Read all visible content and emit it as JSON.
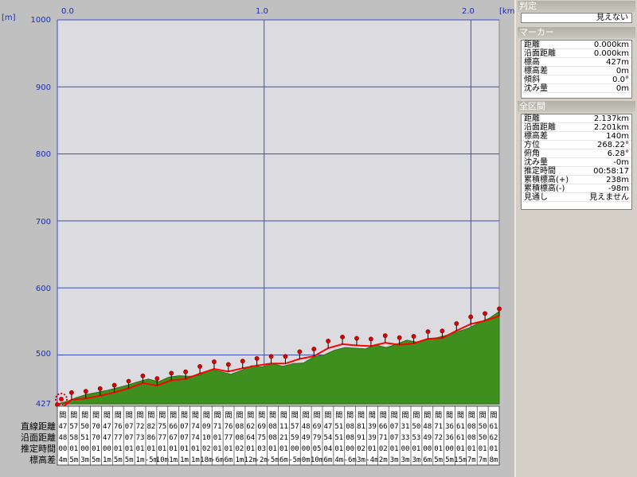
{
  "x_axis": {
    "ticks": [
      "0.0",
      "1.0",
      "2.0"
    ],
    "unit": "[km]"
  },
  "y_axis": {
    "unit": "[m]",
    "ticks": [
      "1000",
      "900",
      "800",
      "700",
      "600",
      "500"
    ],
    "bottom_label": "427"
  },
  "row_labels": [
    "直線距離",
    "沿面距離",
    "推定時間",
    "標高差"
  ],
  "segment_columns": [
    {
      "header": "間",
      "r1": "47",
      "r2": "48",
      "r3": "00",
      "r4": "4m"
    },
    {
      "header": "間",
      "r1": "57",
      "r2": "58",
      "r3": "01",
      "r4": "5m"
    },
    {
      "header": "間",
      "r1": "50",
      "r2": "51",
      "r3": "00",
      "r4": "3m"
    },
    {
      "header": "間",
      "r1": "70",
      "r2": "70",
      "r3": "01",
      "r4": "5m"
    },
    {
      "header": "間",
      "r1": "47",
      "r2": "47",
      "r3": "00",
      "r4": "1m"
    },
    {
      "header": "間",
      "r1": "76",
      "r2": "77",
      "r3": "01",
      "r4": "5m"
    },
    {
      "header": "間",
      "r1": "07",
      "r2": "07",
      "r3": "01",
      "r4": "5m"
    },
    {
      "header": "間",
      "r1": "72",
      "r2": "73",
      "r3": "01",
      "r4": "1m"
    },
    {
      "header": "間",
      "r1": "82",
      "r2": "86",
      "r3": "01",
      "r4": "-5m"
    },
    {
      "header": "間",
      "r1": "75",
      "r2": "77",
      "r3": "01",
      "r4": "10m"
    },
    {
      "header": "間",
      "r1": "66",
      "r2": "67",
      "r3": "01",
      "r4": "1m"
    },
    {
      "header": "間",
      "r1": "07",
      "r2": "07",
      "r3": "01",
      "r4": "1m"
    },
    {
      "header": "間",
      "r1": "74",
      "r2": "74",
      "r3": "01",
      "r4": "1m"
    },
    {
      "header": "間",
      "r1": "09",
      "r2": "10",
      "r3": "02",
      "r4": "18m"
    },
    {
      "header": "間",
      "r1": "71",
      "r2": "01",
      "r3": "01",
      "r4": "-6m"
    },
    {
      "header": "間",
      "r1": "76",
      "r2": "77",
      "r3": "01",
      "r4": "6m"
    },
    {
      "header": "間",
      "r1": "08",
      "r2": "08",
      "r3": "02",
      "r4": "1m"
    },
    {
      "header": "間",
      "r1": "62",
      "r2": "64",
      "r3": "01",
      "r4": "12m"
    },
    {
      "header": "間",
      "r1": "69",
      "r2": "75",
      "r3": "03",
      "r4": "-2m"
    },
    {
      "header": "間",
      "r1": "08",
      "r2": "08",
      "r3": "01",
      "r4": "-5m"
    },
    {
      "header": "間",
      "r1": "11",
      "r2": "21",
      "r3": "01",
      "r4": "6m"
    },
    {
      "header": "間",
      "r1": "57",
      "r2": "59",
      "r3": "00",
      "r4": "-5m"
    },
    {
      "header": "間",
      "r1": "48",
      "r2": "49",
      "r3": "00",
      "r4": "0m"
    },
    {
      "header": "間",
      "r1": "69",
      "r2": "79",
      "r3": "05",
      "r4": "10m"
    },
    {
      "header": "間",
      "r1": "47",
      "r2": "54",
      "r3": "04",
      "r4": "6m"
    },
    {
      "header": "間",
      "r1": "51",
      "r2": "51",
      "r3": "01",
      "r4": "4m"
    },
    {
      "header": "間",
      "r1": "08",
      "r2": "08",
      "r3": "00",
      "r4": "-6m"
    },
    {
      "header": "間",
      "r1": "81",
      "r2": "91",
      "r3": "02",
      "r4": "3m"
    },
    {
      "header": "間",
      "r1": "39",
      "r2": "39",
      "r3": "01",
      "r4": "-4m"
    },
    {
      "header": "間",
      "r1": "66",
      "r2": "71",
      "r3": "02",
      "r4": "2m"
    },
    {
      "header": "間",
      "r1": "07",
      "r2": "07",
      "r3": "01",
      "r4": "3m"
    },
    {
      "header": "間",
      "r1": "31",
      "r2": "33",
      "r3": "00",
      "r4": "3m"
    },
    {
      "header": "間",
      "r1": "50",
      "r2": "53",
      "r3": "01",
      "r4": "3m"
    },
    {
      "header": "間",
      "r1": "48",
      "r2": "49",
      "r3": "00",
      "r4": "6m"
    },
    {
      "header": "間",
      "r1": "71",
      "r2": "72",
      "r3": "01",
      "r4": "5m"
    },
    {
      "header": "間",
      "r1": "36",
      "r2": "36",
      "r3": "00",
      "r4": "5m"
    },
    {
      "header": "間",
      "r1": "61",
      "r2": "61",
      "r3": "01",
      "r4": "15m"
    },
    {
      "header": "間",
      "r1": "08",
      "r2": "08",
      "r3": "01",
      "r4": "7m"
    },
    {
      "header": "間",
      "r1": "50",
      "r2": "50",
      "r3": "01",
      "r4": "7m"
    },
    {
      "header": "間",
      "r1": "61",
      "r2": "62",
      "r3": "01",
      "r4": "8m"
    }
  ],
  "right_panel": {
    "judge_title": "判定",
    "judge_value": "見えない",
    "marker_title": "マーカー",
    "marker_rows": [
      {
        "label": "距離",
        "value": "0.000km"
      },
      {
        "label": "沿面距離",
        "value": "0.000km"
      },
      {
        "label": "標高",
        "value": "427m"
      },
      {
        "label": "標高差",
        "value": "0m"
      },
      {
        "label": "傾斜",
        "value": "0.0°"
      },
      {
        "label": "沈み量",
        "value": "0m"
      }
    ],
    "total_title": "全区間",
    "total_rows": [
      {
        "label": "距離",
        "value": "2.137km"
      },
      {
        "label": "沿面距離",
        "value": "2.201km"
      },
      {
        "label": "標高差",
        "value": "140m"
      },
      {
        "label": "方位",
        "value": "268.22°"
      },
      {
        "label": "俯角",
        "value": "6.28°"
      },
      {
        "label": "沈み量",
        "value": "-0m"
      },
      {
        "label": "推定時間",
        "value": "00:58:17"
      },
      {
        "label": "累積標高(+)",
        "value": "238m"
      },
      {
        "label": "累積標高(-)",
        "value": "-98m"
      },
      {
        "label": "見通し",
        "value": "見えません"
      }
    ]
  },
  "chart_data": {
    "type": "area",
    "xlabel": "[km]",
    "ylabel": "[m]",
    "xlim": [
      0,
      2.137
    ],
    "ylim": [
      427,
      1000
    ],
    "x_ticks": [
      0.0,
      1.0,
      2.0
    ],
    "y_ticks": [
      500,
      600,
      700,
      800,
      900,
      1000
    ],
    "grid": true,
    "terrain_color": "#3f8f1f",
    "route_color": "#ff0000",
    "series": [
      {
        "x": [
          0.0,
          0.05,
          0.09,
          0.14,
          0.19,
          0.24,
          0.29,
          0.34,
          0.39,
          0.44,
          0.49,
          0.54,
          0.59,
          0.64,
          0.69,
          0.74,
          0.79,
          0.84,
          0.89,
          0.94,
          0.99,
          1.04,
          1.09,
          1.14,
          1.19,
          1.24,
          1.29,
          1.34,
          1.39,
          1.44,
          1.49,
          1.54,
          1.59,
          1.64,
          1.69,
          1.74,
          1.79,
          1.84,
          1.89,
          1.94,
          1.99,
          2.04,
          2.09,
          2.137
        ],
        "y": [
          427,
          431,
          436,
          441,
          444,
          447,
          451,
          455,
          460,
          464,
          460,
          467,
          469,
          468,
          470,
          478,
          475,
          471,
          477,
          484,
          482,
          487,
          483,
          487,
          488,
          497,
          500,
          507,
          511,
          510,
          509,
          515,
          511,
          516,
          522,
          519,
          523,
          526,
          530,
          535,
          540,
          548,
          555,
          565
        ]
      }
    ],
    "markers_y": [
      427,
      445,
      447,
      451,
      456,
      462,
      470,
      466,
      474,
      476,
      484,
      491,
      487,
      492,
      496,
      499,
      499,
      506,
      510,
      522,
      528,
      526,
      525,
      530,
      527,
      529,
      536,
      537,
      548,
      558,
      563,
      570
    ]
  }
}
